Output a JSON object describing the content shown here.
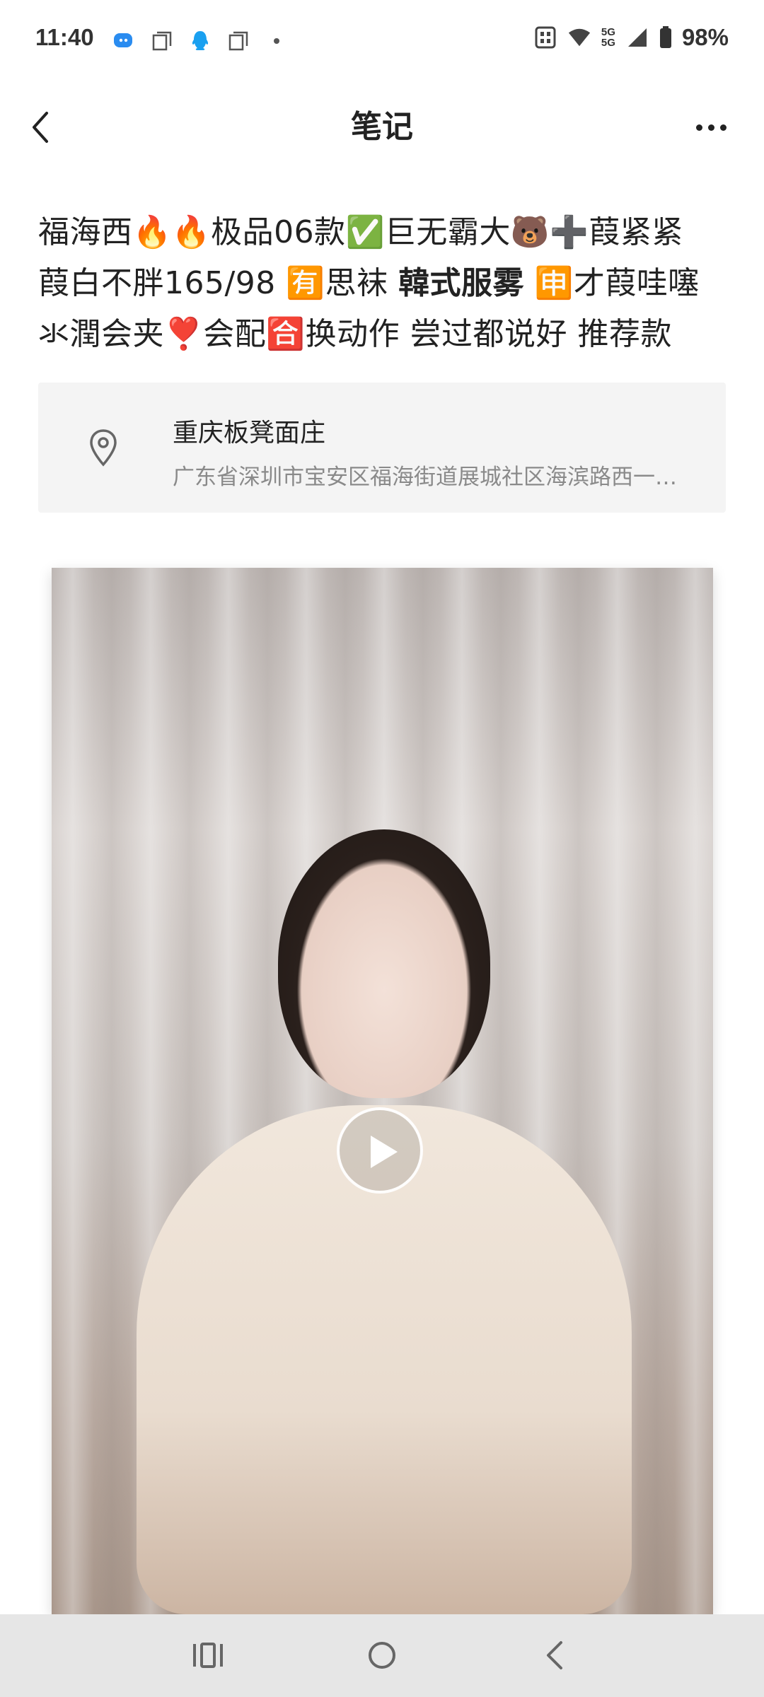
{
  "status_bar": {
    "time": "11:40",
    "battery": "98%",
    "network_top": "5G",
    "network_bottom": "5G"
  },
  "nav": {
    "title": "笔记",
    "back_icon": "chevron-left-icon",
    "more_icon": "more-dots-icon"
  },
  "note": {
    "line1": "福海西🔥🔥极品06款✅巨无霸大🐻➕葭紧紧",
    "line2_a": "葭白不胖165/98 🈶思袜 ",
    "line2_b": "韓式服雾",
    "line2_c": " 🈸才葭哇噻",
    "line3": "氺潤会夹❣️会配🈴换动作 尝过都说好 推荐款"
  },
  "location": {
    "name": "重庆板凳面庄",
    "address": "广东省深圳市宝安区福海街道展城社区海滨路西一…",
    "icon": "location-pin-icon"
  },
  "video": {
    "play_icon": "play-icon"
  },
  "system_nav": {
    "recents_icon": "recents-icon",
    "home_icon": "home-icon",
    "back_icon": "back-icon"
  },
  "colors": {
    "card_bg": "#f4f4f4",
    "nav_bar_bg": "#e6e6e6"
  }
}
